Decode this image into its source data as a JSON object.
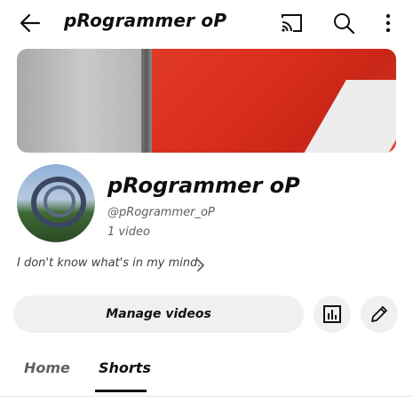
{
  "header": {
    "title": "pRogrammer oP",
    "icons": [
      "back-arrow-icon",
      "cast-icon",
      "search-icon",
      "more-vertical-icon"
    ]
  },
  "channel": {
    "name": "pRogrammer oP",
    "handle": "@pRogrammer_oP",
    "video_count": "1 video",
    "description": "I don't know what's in my mind."
  },
  "actions": {
    "manage_label": "Manage videos",
    "icons": [
      "analytics-icon",
      "edit-pencil-icon"
    ]
  },
  "tabs": [
    {
      "label": "Home",
      "selected": false
    },
    {
      "label": "Shorts",
      "selected": true
    }
  ],
  "colors": {
    "text": "#0f0f0f",
    "secondary_text": "#606060",
    "button_bg": "#f0f0f0",
    "banner_flag": "#d82d1c"
  }
}
